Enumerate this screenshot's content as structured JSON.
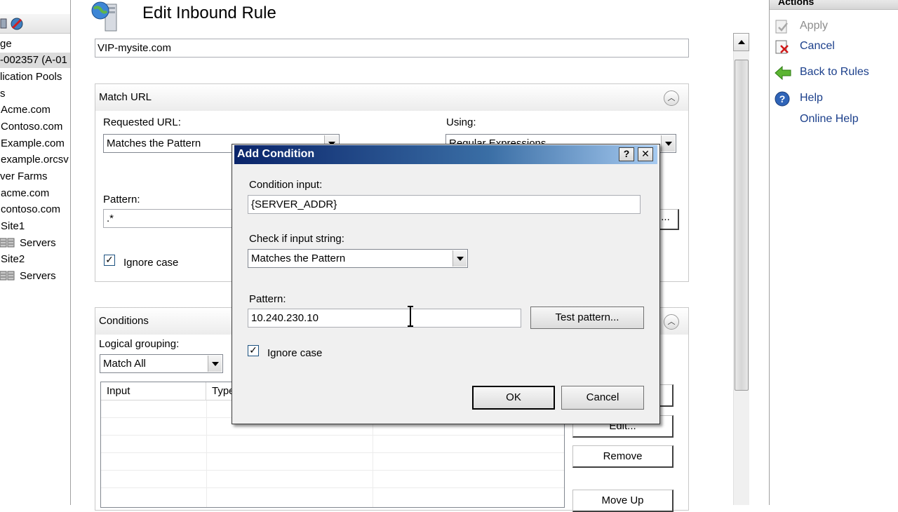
{
  "tree": {
    "items": [
      {
        "label": "ge"
      },
      {
        "label": "-002357 (A-01",
        "selected": true
      },
      {
        "label": "lication Pools"
      },
      {
        "label": "s"
      },
      {
        "label": "Acme.com"
      },
      {
        "label": "Contoso.com"
      },
      {
        "label": "Example.com"
      },
      {
        "label": "example.orcsv"
      },
      {
        "label": "ver Farms"
      },
      {
        "label": "acme.com"
      },
      {
        "label": "contoso.com"
      },
      {
        "label": "Site1"
      },
      {
        "label": "Servers"
      },
      {
        "label": "Site2"
      },
      {
        "label": "Servers"
      }
    ]
  },
  "main": {
    "title": "Edit Inbound Rule",
    "rule_name": "VIP-mysite.com",
    "match_url": {
      "title": "Match URL",
      "requested_url_label": "Requested URL:",
      "requested_url_value": "Matches the Pattern",
      "using_label": "Using:",
      "using_value": "Regular Expressions",
      "pattern_label": "Pattern:",
      "pattern_value": ".*",
      "ignore_case_label": "Ignore case",
      "ignore_case_checked": true,
      "test_pattern_label": "..."
    },
    "conditions": {
      "title": "Conditions",
      "logical_grouping_label": "Logical grouping:",
      "logical_grouping_value": "Match All",
      "columns": [
        "Input",
        "Type",
        "",
        ""
      ],
      "buttons": {
        "edit": "Edit...",
        "remove": "Remove",
        "move_up": "Move Up"
      }
    }
  },
  "actions": {
    "header": "Actions",
    "items": [
      {
        "label": "Apply",
        "icon": "apply-icon",
        "state": "disabled"
      },
      {
        "label": "Cancel",
        "icon": "cancel-icon",
        "state": "link"
      },
      {
        "label": "Back to Rules",
        "icon": "back-arrow-icon",
        "state": "link"
      },
      {
        "label": "Help",
        "icon": "help-icon",
        "state": "link"
      },
      {
        "label": "Online Help",
        "icon": "",
        "state": "link"
      }
    ]
  },
  "dialog": {
    "title": "Add Condition",
    "help_button": "?",
    "close_button": "✕",
    "condition_input_label": "Condition input:",
    "condition_input_value": "{SERVER_ADDR}",
    "check_label": "Check if input string:",
    "check_value": "Matches the Pattern",
    "pattern_label": "Pattern:",
    "pattern_value": "10.240.230.10",
    "test_pattern_button": "Test pattern...",
    "ignore_case_label": "Ignore case",
    "ignore_case_checked": true,
    "ok_button": "OK",
    "cancel_button": "Cancel"
  },
  "colors": {
    "dialog_title_start": "#0a246a",
    "dialog_title_end": "#a6caf0",
    "link_text": "#1b3f8b",
    "disabled_text": "#8c8c8c"
  }
}
